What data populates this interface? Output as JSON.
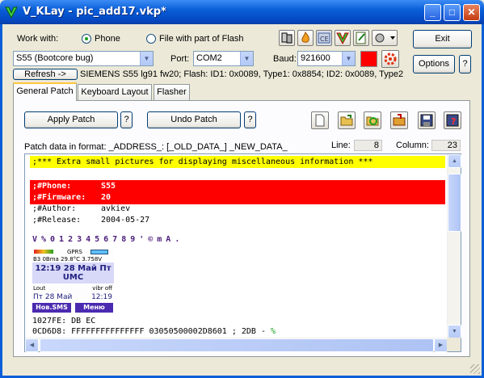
{
  "window": {
    "title": "V_KLay - pic_add17.vkp*"
  },
  "work_with": {
    "label": "Work with:",
    "option_phone": "Phone",
    "option_file": "File with part of Flash",
    "selected": "Phone"
  },
  "device": {
    "model_value": "S55 (Bootcore bug)",
    "port_label": "Port:",
    "port_value": "COM2",
    "baud_label": "Baud:",
    "baud_value": "921600",
    "status_color": "#ff0000",
    "refresh_label": "Refresh ->",
    "info_text": "SIEMENS S55 lg91 fw20; Flash: ID1: 0x0089, Type1: 0x8854; ID2: 0x0089, Type2"
  },
  "side_buttons": {
    "exit": "Exit",
    "options": "Options",
    "help": "?"
  },
  "tabs": [
    {
      "label": "General Patch",
      "active": true
    },
    {
      "label": "Keyboard Layout",
      "active": false
    },
    {
      "label": "Flasher",
      "active": false
    }
  ],
  "patch": {
    "apply_label": "Apply Patch",
    "undo_label": "Undo Patch",
    "help": "?",
    "format_text": "Patch data in format: _ADDRESS_: [_OLD_DATA_] _NEW_DATA_",
    "line_label": "Line:",
    "line_value": "8",
    "column_label": "Column:",
    "column_value": "23"
  },
  "toolbar_icons": [
    "new-file-icon",
    "open-folder-icon",
    "reload-icon",
    "save-as-icon",
    "save-icon",
    "undo-file-icon"
  ],
  "editor": {
    "line1": ";*** Extra small pictures for displaying miscellaneous information ***",
    "phone_key": ";#Phone:",
    "phone_val": "S55",
    "fw_key": ";#Firmware:",
    "fw_val": "20",
    "author_key": ";#Author:",
    "author_val": "avkiev",
    "release_key": ";#Release:",
    "release_val": "2004-05-27",
    "pixel_glyphs": "V%0123456789'©mA.",
    "screen": {
      "gprs": "GPRS",
      "signal": "B3  0Bma  29.8°C  3.758V",
      "time_date": "12:19 28 Май Пт",
      "operator": "UMC",
      "left_soft": "Lout",
      "right_soft": "vibr off",
      "bottom_left": "Пт 28 Май",
      "bottom_right": "12:19",
      "btn_left": "Нов.SMS",
      "btn_right": "Меню"
    },
    "code1": "1027FE: DB EC",
    "code2_a": "0CD6D8: FFFFFFFFFFFFFFF 03050500002D8601 ; 2DB - ",
    "code2_b": "%"
  },
  "colors": {
    "highlight_yellow": "#ffff00",
    "highlight_red": "#ff0000",
    "accent_blue": "#0a5fd9"
  }
}
